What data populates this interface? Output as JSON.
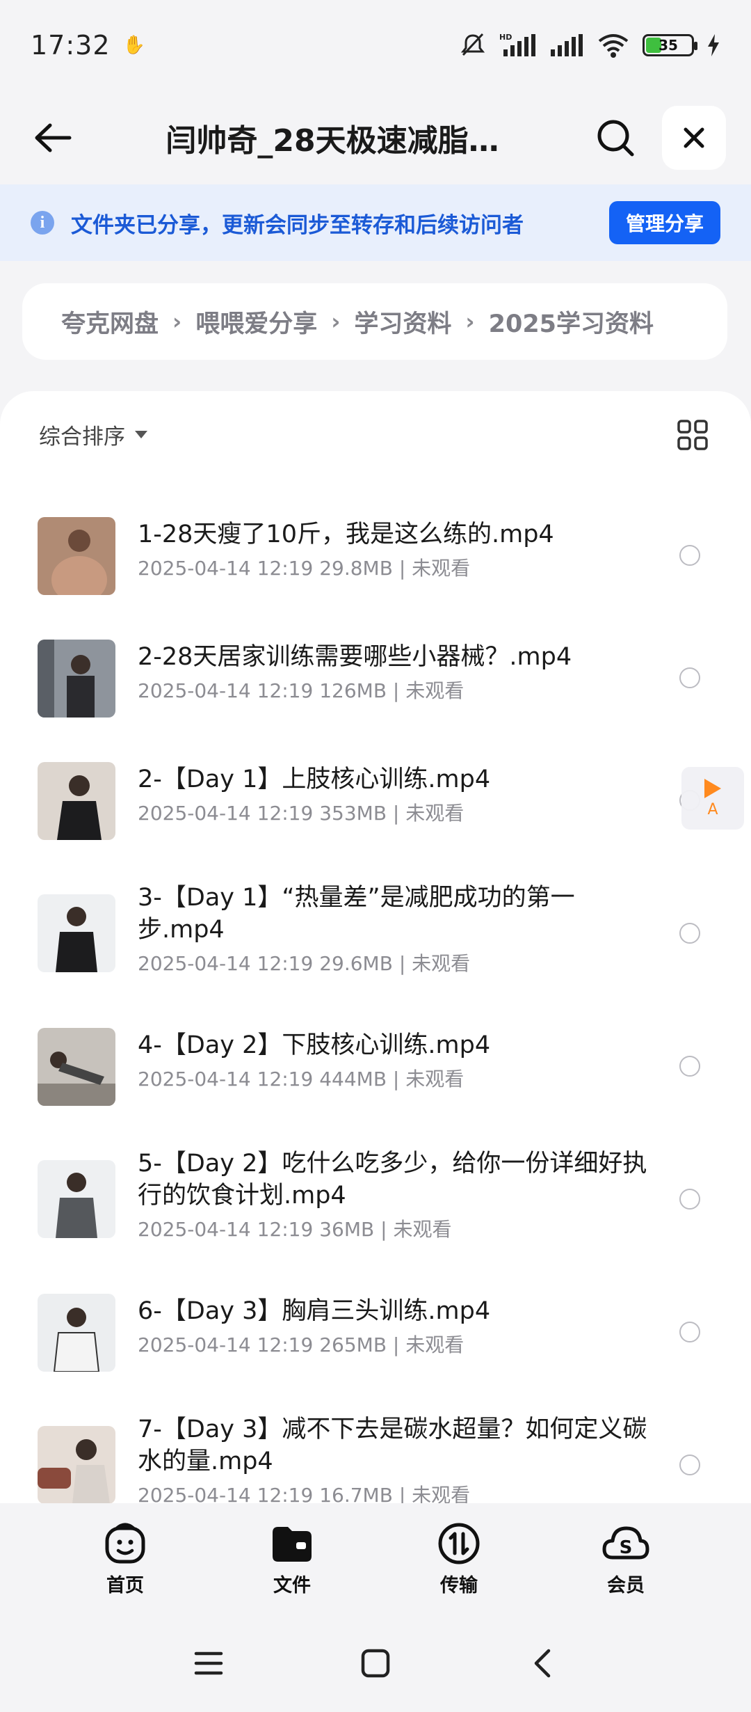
{
  "status_bar": {
    "time": "17:32",
    "battery_level": "35",
    "battery_percent": 35
  },
  "header": {
    "title": "闫帅奇_28天极速减脂…"
  },
  "notice": {
    "text": "文件夹已分享，更新会同步至转存和后续访问者",
    "manage_label": "管理分享"
  },
  "breadcrumb": [
    "夸克网盘",
    "喂喂爱分享",
    "学习资料",
    "2025学习资料"
  ],
  "sort": {
    "label": "综合排序"
  },
  "files": [
    {
      "name": "1-28天瘦了10斤，我是这么练的.mp4",
      "meta": "2025-04-14 12:19  29.8MB | 未观看",
      "thumb_color": "#c9a48c"
    },
    {
      "name": "2-28天居家训练需要哪些小器械？.mp4",
      "meta": "2025-04-14 12:19  126MB | 未观看",
      "thumb_color": "#9aa0a8"
    },
    {
      "name": "2-【Day 1】上肢核心训练.mp4",
      "meta": "2025-04-14 12:19  353MB | 未观看",
      "thumb_color": "#d6cfc8"
    },
    {
      "name": "3-【Day 1】“热量差”是减肥成功的第一步.mp4",
      "meta": "2025-04-14 12:19  29.6MB | 未观看",
      "thumb_color": "#e3e6ea"
    },
    {
      "name": "4-【Day 2】下肢核心训练.mp4",
      "meta": "2025-04-14 12:19  444MB | 未观看",
      "thumb_color": "#b9b4ae"
    },
    {
      "name": "5-【Day 2】吃什么吃多少，给你一份详细好执行的饮食计划.mp4",
      "meta": "2025-04-14 12:19  36MB | 未观看",
      "thumb_color": "#e4e7ea"
    },
    {
      "name": "6-【Day 3】胸肩三头训练.mp4",
      "meta": "2025-04-14 12:19  265MB | 未观看",
      "thumb_color": "#dfe2e5"
    },
    {
      "name": "7-【Day 3】减不下去是碳水超量？如何定义碳水的量.mp4",
      "meta": "2025-04-14 12:19  16.7MB | 未观看",
      "thumb_color": "#d8cfc9"
    }
  ],
  "float_player": {
    "label": "A"
  },
  "tabs": [
    {
      "label": "首页",
      "icon": "smile-face-icon"
    },
    {
      "label": "文件",
      "icon": "folder-icon"
    },
    {
      "label": "传输",
      "icon": "transfer-icon"
    },
    {
      "label": "会员",
      "icon": "cloud-vip-icon"
    }
  ],
  "colors": {
    "accent": "#1462f5",
    "notice_bg": "#e8effc",
    "notice_text": "#1b5ad6",
    "float_accent": "#ff8a1f"
  }
}
